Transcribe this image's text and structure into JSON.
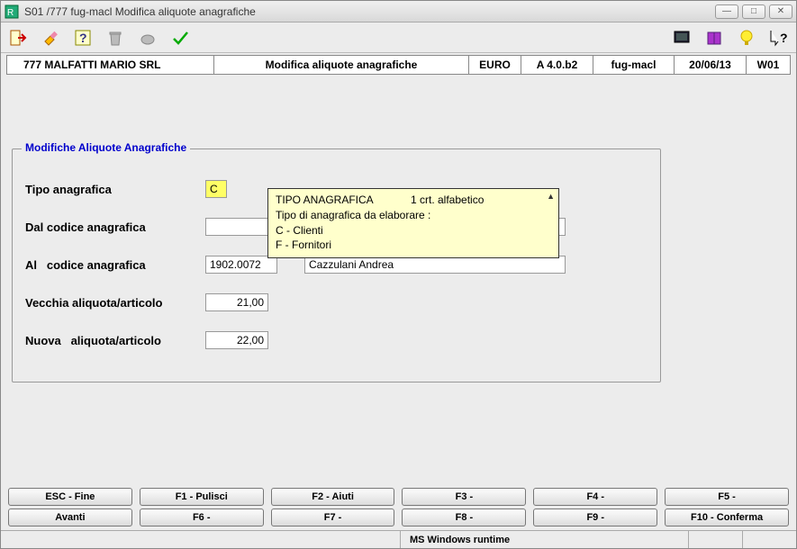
{
  "window": {
    "title": "S01 /777 fug-macl Modifica aliquote anagrafiche"
  },
  "infobar": {
    "company": "777 MALFATTI MARIO SRL",
    "title": "Modifica aliquote anagrafiche",
    "currency": "EURO",
    "version": "A 4.0.b2",
    "module": "fug-macl",
    "date": "20/06/13",
    "workstation": "W01"
  },
  "fieldset": {
    "legend": "Modifiche Aliquote Anagrafiche",
    "rows": {
      "tipo_anag": {
        "label": "Tipo anagrafica",
        "value": "C"
      },
      "dal_codice": {
        "label": "Dal codice anagrafica",
        "code": "",
        "desc": ""
      },
      "al_codice": {
        "label": "Al   codice anagrafica",
        "code": "1902.0072",
        "desc": "Cazzulani Andrea"
      },
      "vecchia": {
        "label": "Vecchia aliquota/articolo",
        "value": "21,00"
      },
      "nuova": {
        "label": "Nuova   aliquota/articolo",
        "value": "22,00"
      }
    }
  },
  "tooltip": {
    "field": "TIPO ANAGRAFICA",
    "meta": "1 crt.   alfabetico",
    "line1": "Tipo di anagrafica da elaborare :",
    "line2": "C - Clienti",
    "line3": "F - Fornitori"
  },
  "fn_buttons": {
    "row1": [
      "ESC - Fine",
      "F1 - Pulisci",
      "F2 -  Aiuti",
      "F3 -",
      "F4 -",
      "F5 -"
    ],
    "row2": [
      "Avanti",
      "F6 -",
      "F7 -",
      "F8 -",
      "F9 -",
      "F10 - Conferma"
    ]
  },
  "status": {
    "runtime": "MS Windows runtime"
  }
}
